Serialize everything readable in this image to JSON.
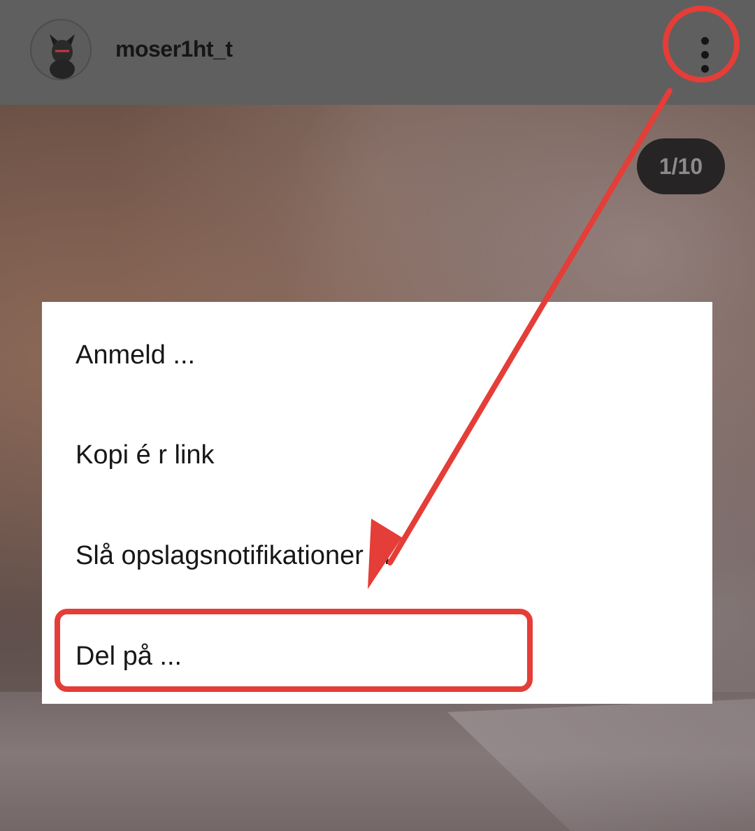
{
  "header": {
    "username": "moser1ht_t",
    "avatar_icon": "avatar-icon",
    "more_icon": "more-vertical-icon"
  },
  "counter": {
    "text": "1/10"
  },
  "menu": {
    "items": [
      {
        "label": "Anmeld ..."
      },
      {
        "label": "Kopi é r link"
      },
      {
        "label": "Slå opslagsnotifikationer til"
      },
      {
        "label": "Del på ..."
      }
    ]
  },
  "annotation": {
    "color": "#e53d37",
    "highlighted_item": "Del på ..."
  }
}
